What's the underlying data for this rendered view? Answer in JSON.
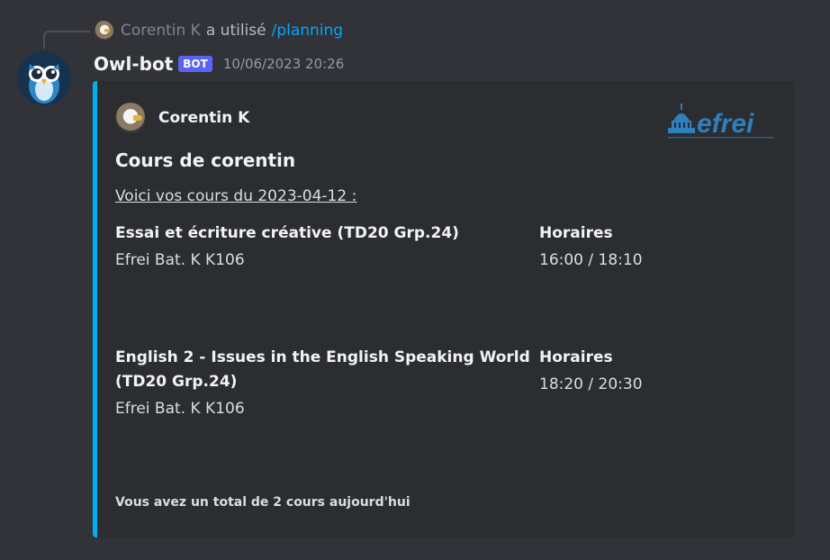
{
  "reply": {
    "user": "Corentin K",
    "action": "a utilisé",
    "command": "/planning"
  },
  "message": {
    "author": "Owl-bot",
    "badge": "BOT",
    "timestamp": "10/06/2023 20:26"
  },
  "embed": {
    "accent_color": "#00b0f4",
    "author": "Corentin K",
    "title": "Cours de corentin",
    "description": "Voici vos cours du 2023-04-12 :",
    "fields": [
      {
        "name": "Essai et écriture créative (TD20 Grp.24)",
        "value": "Efrei Bat. K K106",
        "time_label": "Horaires",
        "time": "16:00 / 18:10"
      },
      {
        "name_line1": "English 2 - Issues in the English Speaking World",
        "name_line2": "(TD20 Grp.24)",
        "value": "Efrei Bat. K K106",
        "time_label": "Horaires",
        "time": "18:20 / 20:30"
      }
    ],
    "footer": "Vous avez un total de 2 cours aujourd'hui",
    "thumbnail_text": "eFrei"
  }
}
